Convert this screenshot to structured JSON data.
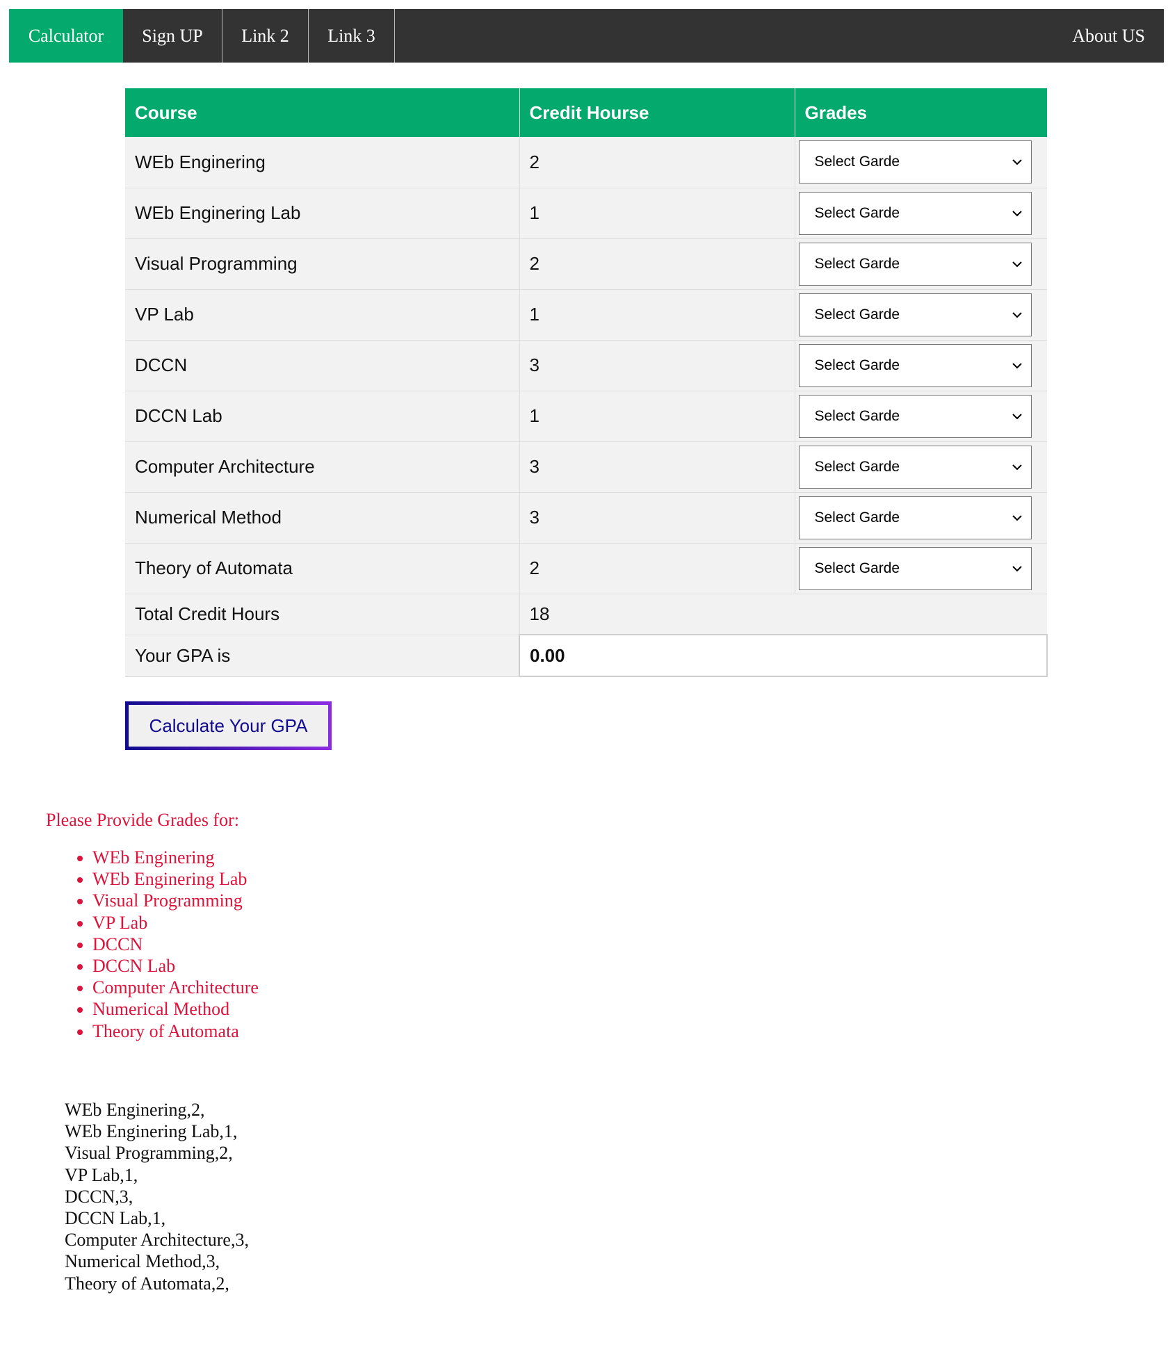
{
  "nav": {
    "items": [
      "Calculator",
      "Sign UP",
      "Link 2",
      "Link 3"
    ],
    "right": "About US"
  },
  "table": {
    "headers": {
      "course": "Course",
      "credit": "Credit Hourse",
      "grades": "Grades"
    },
    "select_placeholder": "Select Garde",
    "rows": [
      {
        "course": "WEb Enginering",
        "credit": "2"
      },
      {
        "course": "WEb Enginering Lab",
        "credit": "1"
      },
      {
        "course": "Visual Programming",
        "credit": "2"
      },
      {
        "course": "VP Lab",
        "credit": "1"
      },
      {
        "course": "DCCN",
        "credit": "3"
      },
      {
        "course": "DCCN Lab",
        "credit": "1"
      },
      {
        "course": "Computer Architecture",
        "credit": "3"
      },
      {
        "course": "Numerical Method",
        "credit": "3"
      },
      {
        "course": "Theory of Automata",
        "credit": "2"
      }
    ],
    "total_label": "Total Credit Hours",
    "total_value": "18",
    "gpa_label": "Your GPA is",
    "gpa_value": "0.00"
  },
  "button": {
    "label": "Calculate Your GPA"
  },
  "warning": {
    "title": "Please Provide Grades for:",
    "items": [
      "WEb Enginering",
      "WEb Enginering Lab",
      "Visual Programming",
      "VP Lab",
      "DCCN",
      "DCCN Lab",
      "Computer Architecture",
      "Numerical Method",
      "Theory of Automata"
    ]
  },
  "summary": [
    "WEb Enginering,2,",
    "WEb Enginering Lab,1,",
    "Visual Programming,2,",
    "VP Lab,1,",
    "DCCN,3,",
    "DCCN Lab,1,",
    "Computer Architecture,3,",
    "Numerical Method,3,",
    "Theory of Automata,2,"
  ],
  "colors": {
    "nav_bg": "#333333",
    "accent": "#04aa6d",
    "warning": "#dc143c",
    "button_text": "#120a8f"
  },
  "icons": {
    "select_arrow": "chevron-down-icon"
  }
}
